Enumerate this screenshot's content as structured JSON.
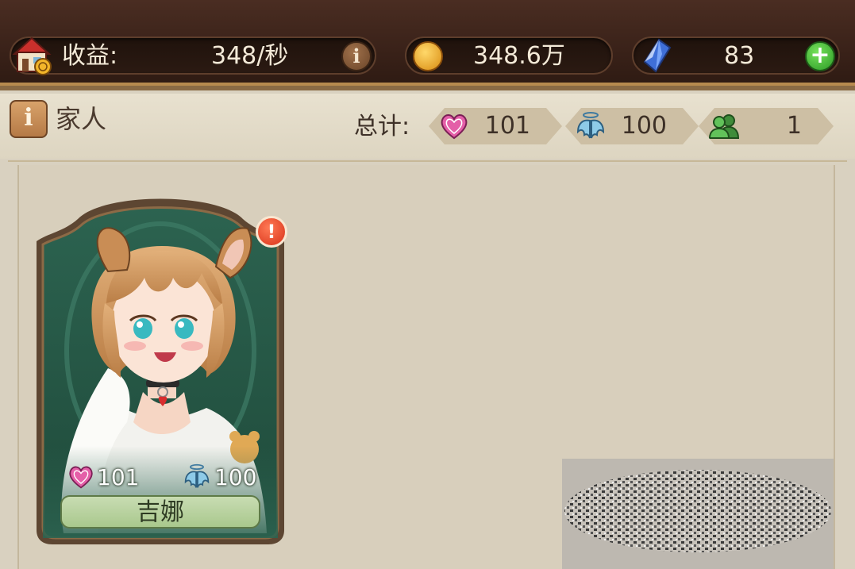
{
  "resources": {
    "income_label": "收益:",
    "income_value": "348/秒",
    "coins_value": "348.6万",
    "gems_value": "83"
  },
  "header": {
    "title": "家人",
    "total_label": "总计:",
    "affection_total": "101",
    "angel_total": "100",
    "members_total": "1"
  },
  "characters": [
    {
      "name": "吉娜",
      "affection": "101",
      "angel": "100",
      "has_alert": true
    }
  ],
  "icons": {
    "house": "house-coin-icon",
    "info": "info-icon",
    "coin": "gold-coin-icon",
    "gem": "blue-gem-icon",
    "plus": "plus-icon",
    "heart": "heart-icon",
    "angel": "angel-wings-icon",
    "members": "people-icon",
    "alert": "exclamation-icon"
  },
  "colors": {
    "topbar": "#3a2219",
    "panel": "#d8cfbc",
    "card_green": "#2f5f49",
    "heart_pink": "#e45fa8",
    "angel_blue": "#6fb4d8",
    "members_green": "#4ea548"
  }
}
